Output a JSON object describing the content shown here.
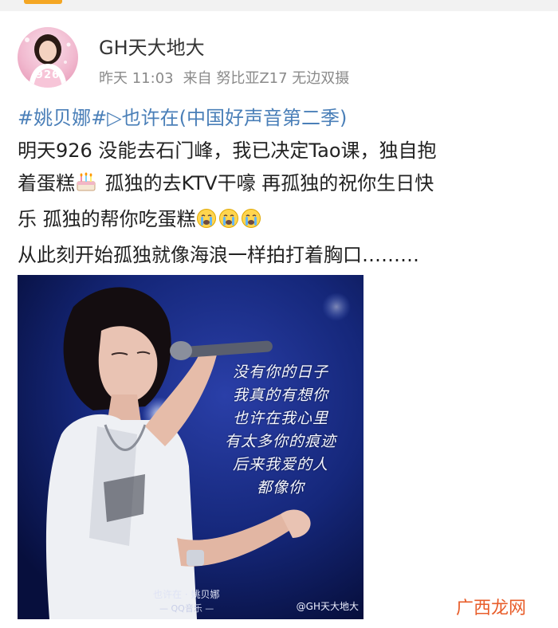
{
  "colors": {
    "topic_link": "#4a7fb8",
    "top_accent": "#f4a623",
    "site_watermark": "#e85d2a",
    "photo_background": "#0c1a5c"
  },
  "post": {
    "author": {
      "name": "GH天大地大",
      "avatar_badge": "926",
      "avatar_icon": "user-avatar-photo"
    },
    "meta": {
      "time": "昨天 11:03",
      "source": "来自 努比亚Z17 无边双摄"
    },
    "topic_line": "#姚贝娜#▷也许在(中国好声音第二季)",
    "text_lines": [
      "明天926  没能去石门峰，我已决定Tao课，独自抱",
      "着蛋糕",
      "  孤独的去KTV干嚎  再孤独的祝你生日快",
      "乐  孤独的帮你吃蛋糕",
      "从此刻开始孤独就像海浪一样拍打着胸口………"
    ],
    "emojis": {
      "cake": "birthday-cake-emoji",
      "crying": "crying-face-emoji"
    },
    "image": {
      "lyrics": [
        "没有你的日子",
        "我真的有想你",
        "也许在我心里",
        "有太多你的痕迹",
        "后来我爱的人",
        "都像你"
      ],
      "song_caption": "也许在 · 姚贝娜",
      "app_caption": "— QQ音乐 —",
      "watermark": "@GH天大地大"
    }
  },
  "site_watermark": "广西龙网"
}
